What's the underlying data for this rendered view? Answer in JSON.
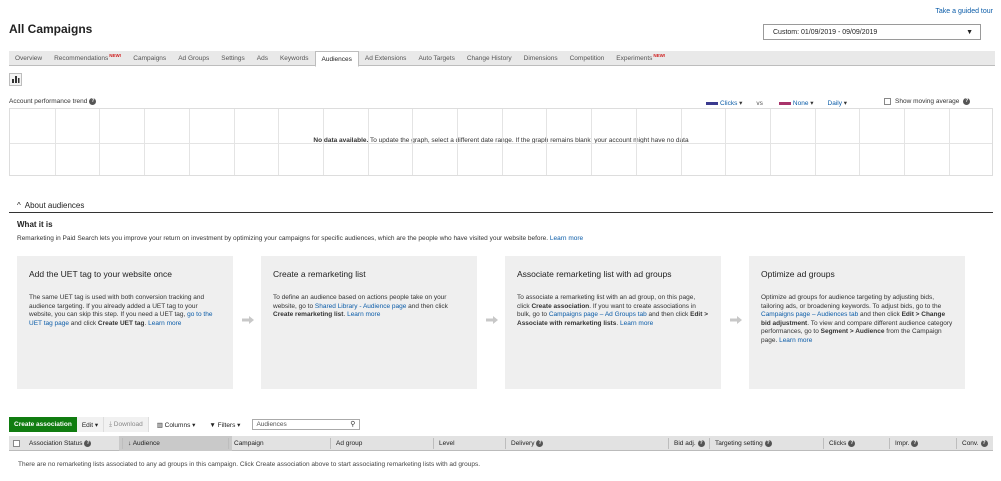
{
  "header": {
    "guided_tour": "Take a guided tour",
    "title": "All Campaigns",
    "date_range": "Custom: 01/09/2019 - 09/09/2019"
  },
  "tabs": [
    {
      "label": "Overview",
      "new": ""
    },
    {
      "label": "Recommendations",
      "new": "NEW!"
    },
    {
      "label": "Campaigns",
      "new": ""
    },
    {
      "label": "Ad Groups",
      "new": ""
    },
    {
      "label": "Settings",
      "new": ""
    },
    {
      "label": "Ads",
      "new": ""
    },
    {
      "label": "Keywords",
      "new": ""
    },
    {
      "label": "Audiences",
      "new": "",
      "active": true
    },
    {
      "label": "Ad Extensions",
      "new": ""
    },
    {
      "label": "Auto Targets",
      "new": ""
    },
    {
      "label": "Change History",
      "new": ""
    },
    {
      "label": "Dimensions",
      "new": ""
    },
    {
      "label": "Competition",
      "new": ""
    },
    {
      "label": "Experiments",
      "new": "NEW!"
    }
  ],
  "chart_toggle_icon": "bar-chart-icon",
  "trend": {
    "label": "Account performance trend",
    "metric1": "Clicks",
    "metric1_color": "#3b3b8f",
    "vs": "vs",
    "metric2": "None",
    "metric2_color": "#a8336a",
    "period": "Daily",
    "moving_average": "Show moving average",
    "no_data_bold": "No data available.",
    "no_data_rest": " To update the graph, select a different date range. If the graph remains blank, your account might have no data"
  },
  "about": {
    "toggle": "About audiences",
    "what_is": "What it is",
    "description": "Remarketing in Paid Search lets you improve your return on investment by optimizing your campaigns for specific audiences, which are the people who have visited your website before.",
    "learn_more": "Learn more",
    "cards": [
      {
        "title": "Add the UET tag to your website once",
        "t1": "The same UET tag is used with both conversion tracking and audience targeting. If you already added a UET tag to your website, you can skip this step. If you need a UET tag, ",
        "link1": "go to the UET tag page",
        "t2": " and click ",
        "bold1": "Create UET tag",
        "t3": ". ",
        "learn": "Learn more"
      },
      {
        "title": "Create a remarketing list",
        "t1": "To define an audience based on actions people take on your website, go to ",
        "link1": "Shared Library - Audience page",
        "t2": " and then click ",
        "bold1": "Create remarketing list",
        "t3": ". ",
        "learn": "Learn more"
      },
      {
        "title": "Associate remarketing list with ad groups",
        "t1": "To associate a remarketing list with an ad group, on this page, click ",
        "bold1": "Create association",
        "t2": ". If you want to create associations in bulk, go to ",
        "link1": "Campaigns page – Ad Groups tab",
        "t3": " and then click ",
        "bold2": "Edit > Associate with remarketing lists",
        "t4": ". ",
        "learn": "Learn more"
      },
      {
        "title": "Optimize ad groups",
        "t1": "Optimize ad groups for audience targeting by adjusting bids, tailoring ads, or broadening keywords. To adjust bids, go to the ",
        "link1": "Campaigns page – Audiences tab",
        "t2": " and then click ",
        "bold1": "Edit > Change bid adjustment",
        "t3": ". To view and compare different audience category performances, go to ",
        "bold2": "Segment > Audience",
        "t4": " from the Campaign page. ",
        "learn": "Learn more"
      }
    ]
  },
  "toolbar": {
    "create": "Create association",
    "edit": "Edit",
    "download": "Download",
    "columns": "Columns",
    "filters": "Filters",
    "search_placeholder": "Audiences"
  },
  "table": {
    "columns": [
      "Association Status",
      "Audience",
      "Campaign",
      "Ad group",
      "Level",
      "Delivery",
      "Bid adj.",
      "Targeting setting",
      "Clicks",
      "Impr.",
      "Conv."
    ],
    "empty_message": "There are no remarketing lists associated to any ad groups in this campaign. Click Create association above to start associating remarketing lists with ad groups."
  }
}
